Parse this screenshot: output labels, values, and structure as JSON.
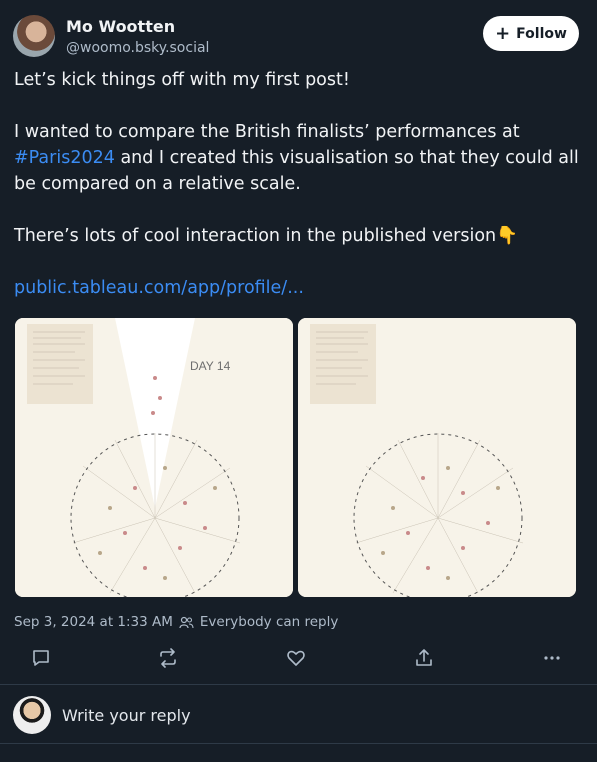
{
  "author": {
    "name": "Mo Wootten",
    "handle": "@woomo.bsky.social"
  },
  "follow_label": "Follow",
  "post": {
    "line1": "Let’s kick things off with my first post!",
    "line2_pre": "I wanted to compare the British finalists’ performances at ",
    "hashtag": "#Paris2024",
    "line2_post": " and I created this visualisation so that they could all be compared on a relative scale.",
    "line3": "There’s lots of cool interaction in the published version👇",
    "link": "public.tableau.com/app/profile/..."
  },
  "images": {
    "day_label": "DAY 14"
  },
  "meta": {
    "timestamp": "Sep 3, 2024 at 1:33 AM",
    "reply_setting": "Everybody can reply"
  },
  "reply_placeholder": "Write your reply"
}
